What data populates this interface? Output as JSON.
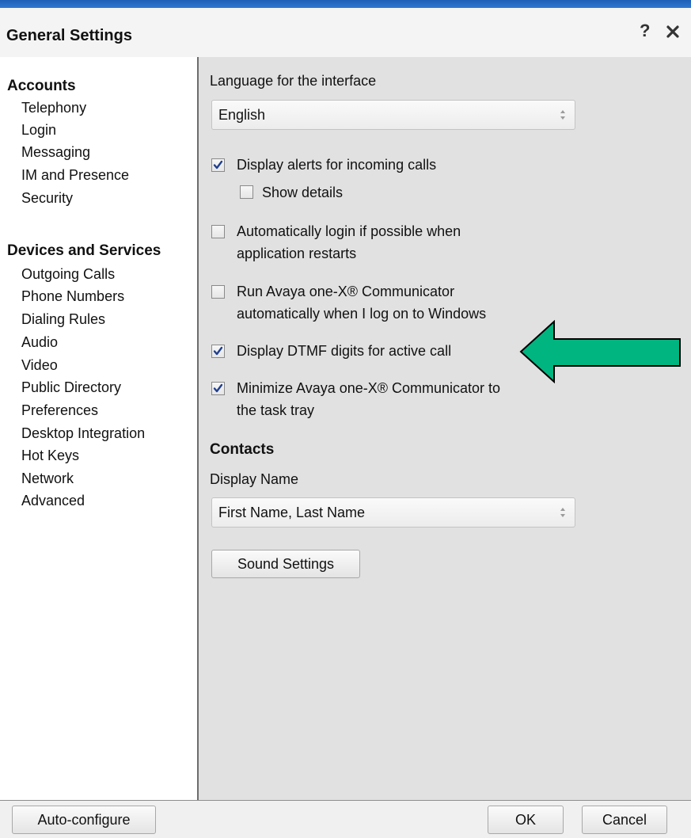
{
  "window": {
    "title": "General Settings",
    "help_label": "?",
    "close_label": "close"
  },
  "sidebar": {
    "sections": [
      {
        "heading": "Accounts",
        "items": [
          "Telephony",
          "Login",
          "Messaging",
          "IM and Presence",
          "Security"
        ]
      },
      {
        "heading": "Devices and Services",
        "items": [
          "Outgoing Calls",
          "Phone Numbers",
          "Dialing Rules",
          "Audio",
          "Video",
          "Public Directory",
          "Preferences",
          "Desktop Integration",
          "Hot Keys",
          "Network",
          "Advanced"
        ]
      }
    ]
  },
  "main": {
    "language_label": "Language for the interface",
    "language_value": "English",
    "options": {
      "display_alerts": {
        "line1": "Display alerts for incoming calls",
        "checked": true
      },
      "show_details": {
        "line1": "Show details",
        "checked": false
      },
      "auto_login": {
        "line1": "Automatically login if possible when",
        "line2": "application restarts",
        "checked": false
      },
      "run_on_logon": {
        "line1": "Run Avaya one-X® Communicator",
        "line2": "automatically when I log on to Windows",
        "checked": false
      },
      "display_dtmf": {
        "line1": "Display DTMF digits for active call",
        "checked": true
      },
      "minimize_tray": {
        "line1": "Minimize Avaya one-X® Communicator to",
        "line2": "the task tray",
        "checked": true
      }
    },
    "contacts_heading": "Contacts",
    "display_name_label": "Display Name",
    "display_name_value": "First Name, Last Name",
    "sound_settings_label": "Sound Settings"
  },
  "footer": {
    "auto_configure_label": "Auto-configure",
    "ok_label": "OK",
    "cancel_label": "Cancel"
  },
  "annotation": {
    "arrow_color": "#00b57f",
    "arrow_outline": "#000000",
    "points_to": "display_dtmf"
  },
  "colors": {
    "title_bar_accent": "#2f78d0",
    "content_bg": "#e1e1e1",
    "sidebar_bg": "#ffffff"
  }
}
